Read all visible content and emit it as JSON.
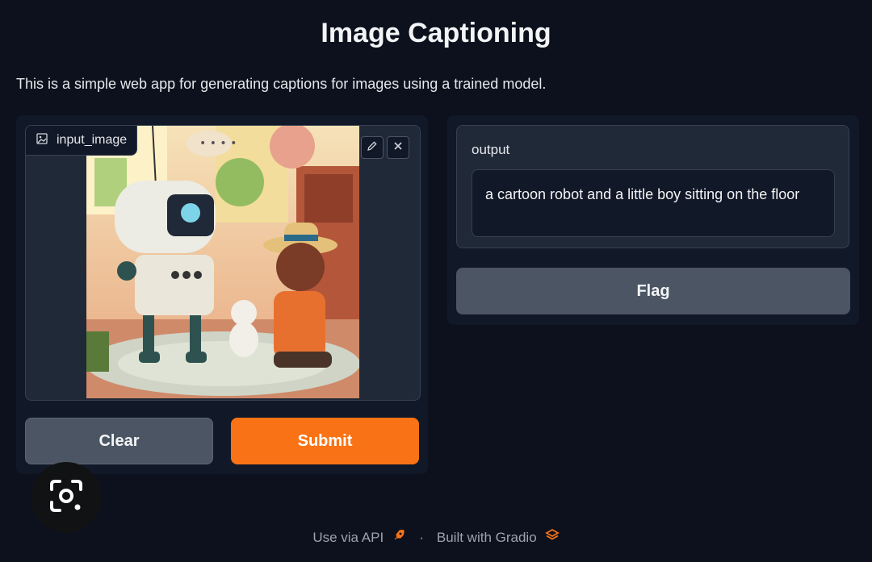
{
  "page": {
    "title": "Image Captioning",
    "description": "This is a simple web app for generating captions for images using a trained model."
  },
  "input": {
    "label": "input_image",
    "image_icon": "image-icon",
    "edit_icon": "pencil-icon",
    "close_icon": "close-icon"
  },
  "buttons": {
    "clear": "Clear",
    "submit": "Submit",
    "flag": "Flag"
  },
  "output": {
    "label": "output",
    "value": "a cartoon robot and a little boy sitting on the floor"
  },
  "footer": {
    "api": "Use via API",
    "separator": "·",
    "built": "Built with Gradio"
  },
  "colors": {
    "background": "#0c111d",
    "accent": "#f97316",
    "button_secondary": "#4b5563"
  }
}
